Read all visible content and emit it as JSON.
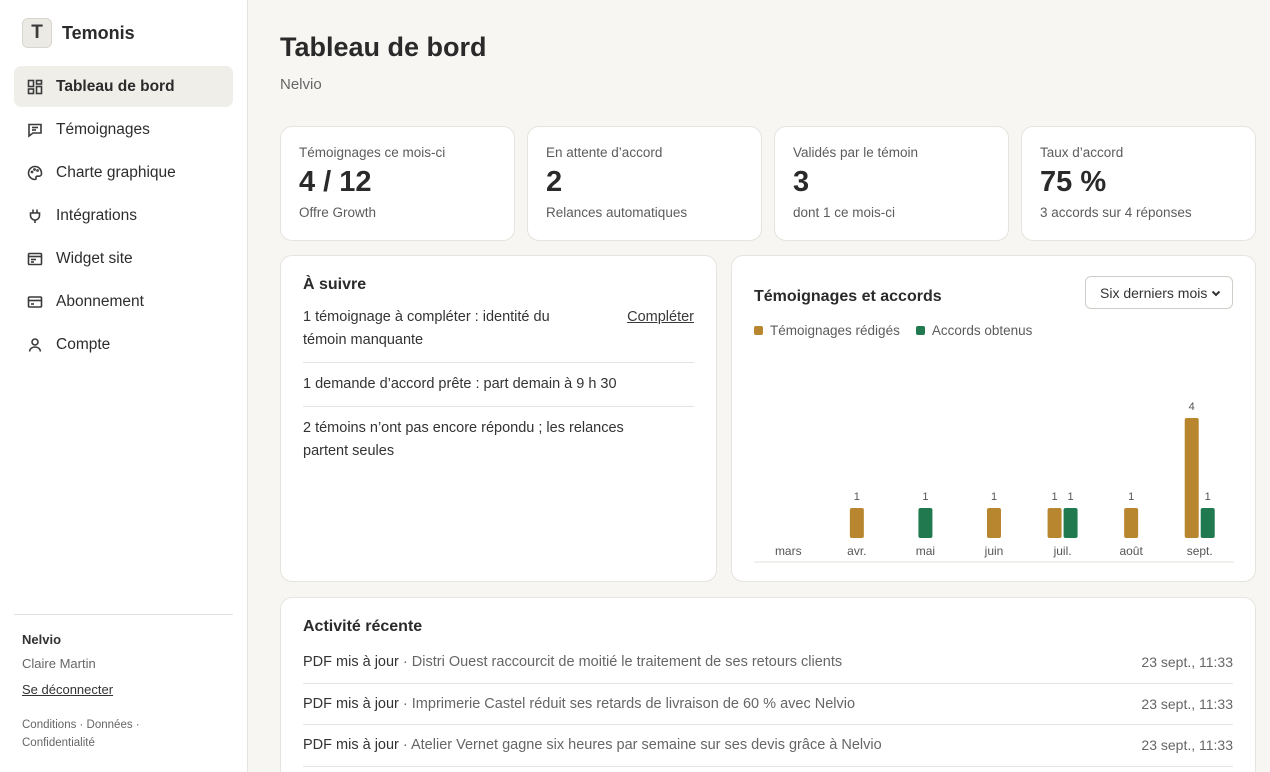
{
  "brand": {
    "logo_letter": "T",
    "name": "Temonis"
  },
  "nav": [
    {
      "label": "Tableau de bord",
      "icon": "dashboard-icon",
      "active": true
    },
    {
      "label": "Témoignages",
      "icon": "message-icon"
    },
    {
      "label": "Charte graphique",
      "icon": "palette-icon"
    },
    {
      "label": "Intégrations",
      "icon": "plug-icon"
    },
    {
      "label": "Widget site",
      "icon": "widget-icon"
    },
    {
      "label": "Abonnement",
      "icon": "credit-card-icon"
    },
    {
      "label": "Compte",
      "icon": "user-icon"
    }
  ],
  "account": {
    "org": "Nelvio",
    "user": "Claire Martin",
    "logout": "Se déconnecter",
    "legal": "Conditions · Données · Confidentialité"
  },
  "page": {
    "title": "Tableau de bord",
    "subtitle": "Nelvio"
  },
  "stats": [
    {
      "label": "Témoignages ce mois-ci",
      "value": "4 / 12",
      "note": "Offre Growth"
    },
    {
      "label": "En attente d’accord",
      "value": "2",
      "note": "Relances automatiques"
    },
    {
      "label": "Validés par le témoin",
      "value": "3",
      "note": "dont 1 ce mois-ci"
    },
    {
      "label": "Taux d’accord",
      "value": "75 %",
      "note": "3 accords sur 4 réponses"
    }
  ],
  "todo": {
    "title": "À suivre",
    "items": [
      {
        "text": "1 témoignage à compléter : identité du témoin manquante",
        "action": "Compléter"
      },
      {
        "text": "1 demande d’accord prête : part demain à 9 h 30"
      },
      {
        "text": "2 témoins n’ont pas encore répondu ; les relances partent seules"
      }
    ]
  },
  "chart": {
    "title": "Témoignages et accords",
    "period": "Six derniers mois"
  },
  "chart_data": {
    "type": "bar",
    "categories": [
      "mars",
      "avr.",
      "mai",
      "juin",
      "juil.",
      "août",
      "sept."
    ],
    "series": [
      {
        "name": "Témoignages rédigés",
        "color": "#b8862f",
        "values": [
          0,
          1,
          0,
          1,
          1,
          1,
          4
        ]
      },
      {
        "name": "Accords obtenus",
        "color": "#217a4f",
        "values": [
          0,
          0,
          1,
          0,
          1,
          0,
          1
        ]
      }
    ],
    "ylim": [
      0,
      4
    ],
    "grid": false,
    "legend": "top-left"
  },
  "activity": {
    "title": "Activité récente",
    "rows": [
      {
        "kind": "PDF mis à jour",
        "desc": "Distri Ouest raccourcit de moitié le traitement de ses retours clients",
        "time": "23 sept., 11:33"
      },
      {
        "kind": "PDF mis à jour",
        "desc": "Imprimerie Castel réduit ses retards de livraison de 60 % avec Nelvio",
        "time": "23 sept., 11:33"
      },
      {
        "kind": "PDF mis à jour",
        "desc": "Atelier Vernet gagne six heures par semaine sur ses devis grâce à Nelvio",
        "time": "23 sept., 11:33"
      }
    ]
  }
}
